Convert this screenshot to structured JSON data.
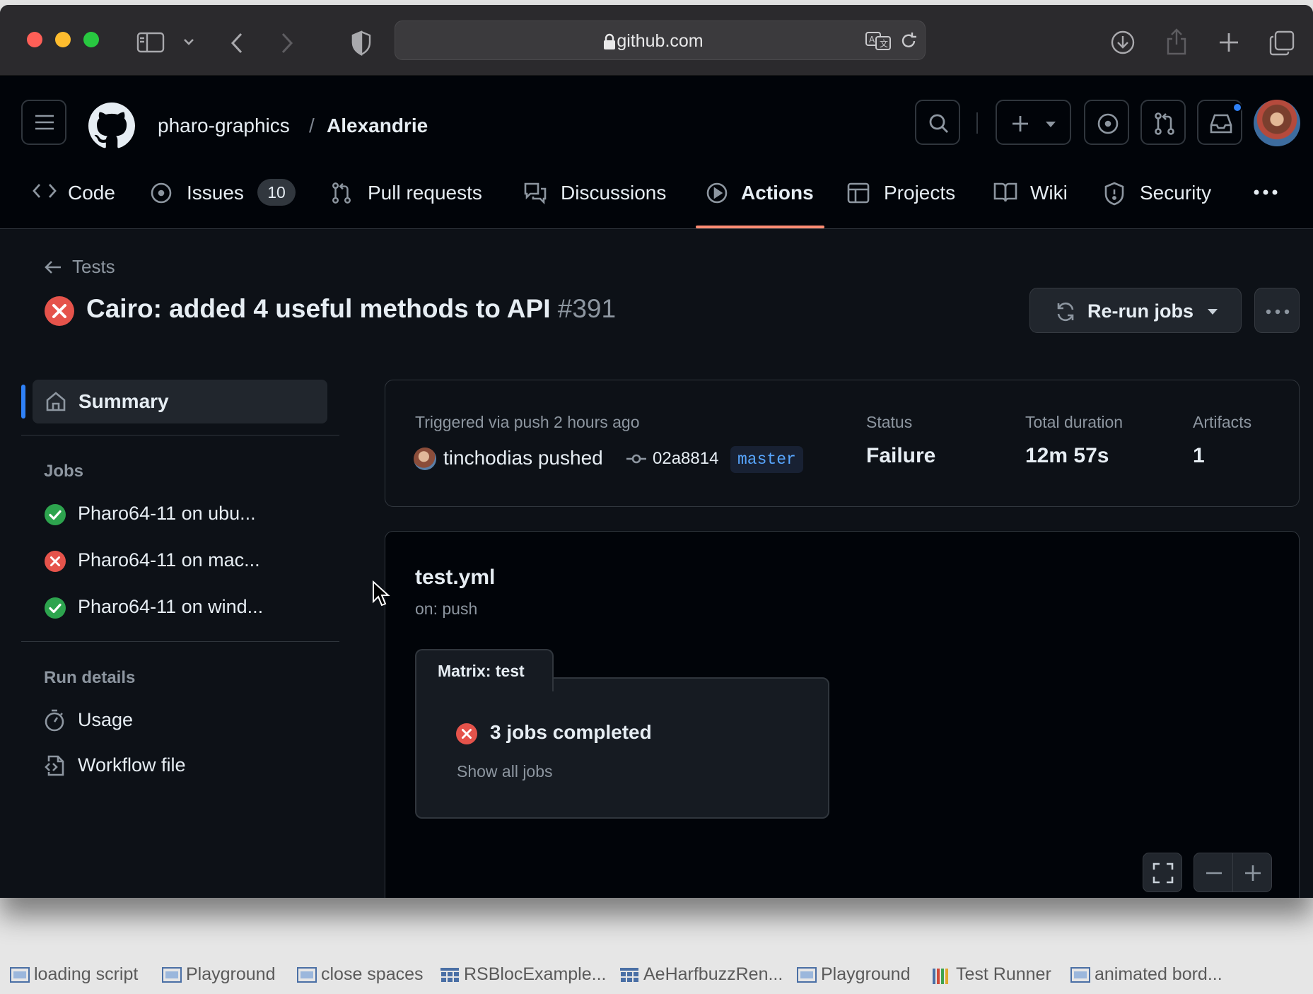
{
  "browser": {
    "url": "github.com"
  },
  "header": {
    "owner": "pharo-graphics",
    "separator": "/",
    "repo": "Alexandrie"
  },
  "nav": {
    "code": "Code",
    "issues": "Issues",
    "issues_count": "10",
    "pull_requests": "Pull requests",
    "discussions": "Discussions",
    "actions": "Actions",
    "projects": "Projects",
    "wiki": "Wiki",
    "security": "Security"
  },
  "page": {
    "back_label": "Tests",
    "title": "Cairo: added 4 useful methods to API",
    "run_number": "#391",
    "rerun_label": "Re-run jobs"
  },
  "sidebar": {
    "summary": "Summary",
    "jobs_heading": "Jobs",
    "jobs": [
      {
        "label": "Pharo64-11 on ubu...",
        "status": "success"
      },
      {
        "label": "Pharo64-11 on mac...",
        "status": "failure"
      },
      {
        "label": "Pharo64-11 on wind...",
        "status": "success"
      }
    ],
    "run_details_heading": "Run details",
    "usage": "Usage",
    "workflow_file": "Workflow file"
  },
  "summary": {
    "triggered": "Triggered via push 2 hours ago",
    "pushed_by": "tinchodias pushed",
    "commit": "02a8814",
    "branch": "master",
    "status_label": "Status",
    "status_value": "Failure",
    "duration_label": "Total duration",
    "duration_value": "12m 57s",
    "artifacts_label": "Artifacts",
    "artifacts_value": "1"
  },
  "workflow": {
    "file": "test.yml",
    "trigger": "on: push",
    "matrix_label": "Matrix: test",
    "jobs_completed": "3 jobs completed",
    "show_all": "Show all jobs"
  },
  "taskbar": [
    {
      "label": "loading script",
      "icon": "window-icon"
    },
    {
      "label": "Playground",
      "icon": "window-icon"
    },
    {
      "label": "close spaces",
      "icon": "window-icon"
    },
    {
      "label": "RSBlocExample...",
      "icon": "grid-window-icon"
    },
    {
      "label": "AeHarfbuzzRen...",
      "icon": "grid-window-icon"
    },
    {
      "label": "Playground",
      "icon": "window-icon"
    },
    {
      "label": "Test Runner",
      "icon": "test-runner-icon"
    },
    {
      "label": "animated bord...",
      "icon": "window-icon"
    }
  ],
  "colors": {
    "success": "#2da44e",
    "failure": "#e5534b",
    "accent_underline": "#fd8c73",
    "link": "#58a6ff"
  }
}
